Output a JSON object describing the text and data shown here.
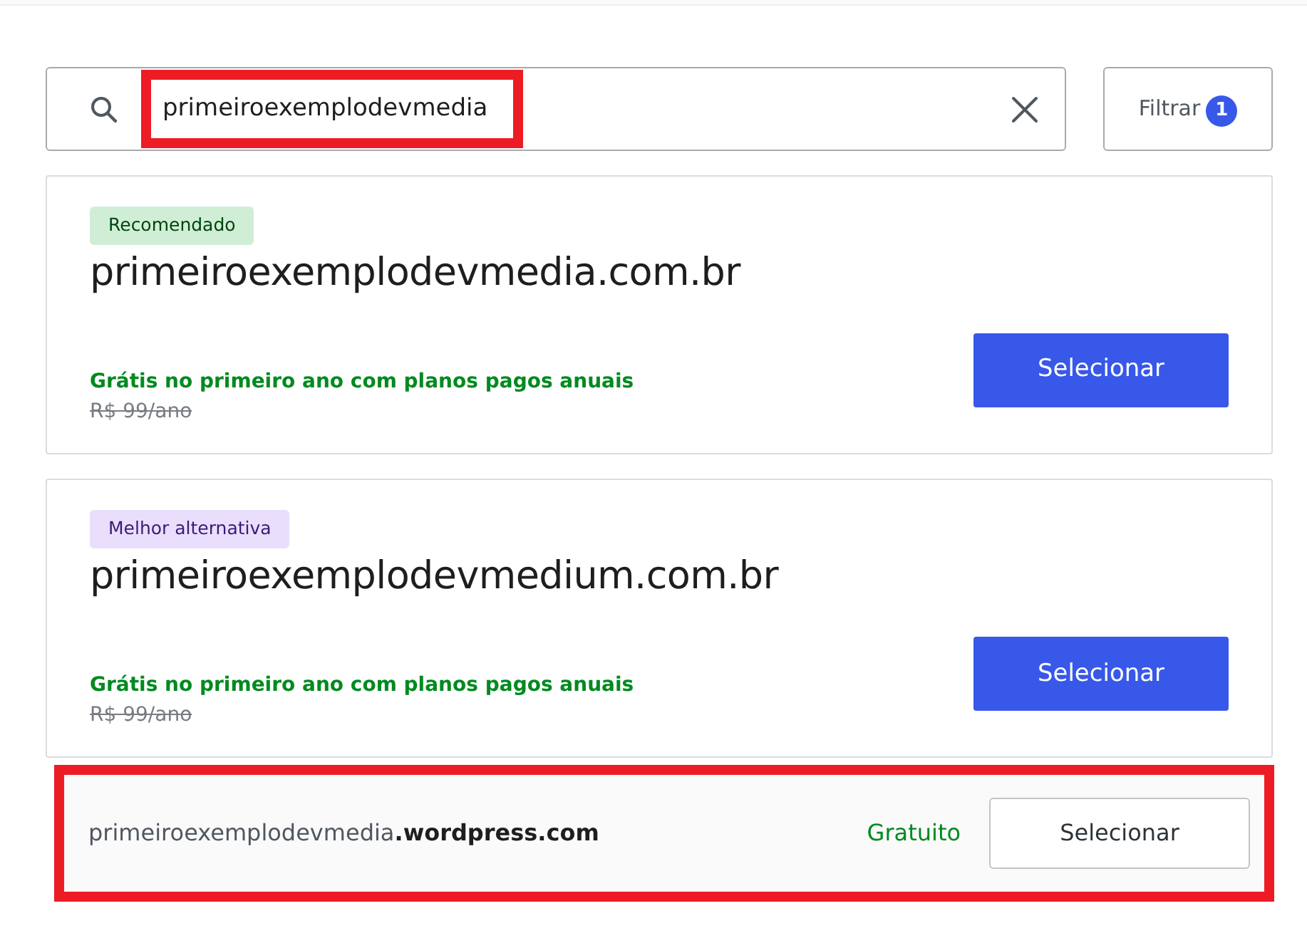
{
  "search": {
    "value": "primeiroexemplodevmedia",
    "highlighted": true
  },
  "filter": {
    "label": "Filtrar",
    "count": "1"
  },
  "suggestions": [
    {
      "badge": "Recomendado",
      "kind": "recommended",
      "domain": "primeiroexemplodevmedia.com.br",
      "offer": "Grátis no primeiro ano com planos pagos anuais",
      "old_price": "R$ 99/ano",
      "button": "Selecionar"
    },
    {
      "badge": "Melhor alternativa",
      "kind": "alternative",
      "domain": "primeiroexemplodevmedium.com.br",
      "offer": "Grátis no primeiro ano com planos pagos anuais",
      "old_price": "R$ 99/ano",
      "button": "Selecionar"
    }
  ],
  "free_option": {
    "domain": "primeiroexemplodevmedia**.wordpress.com**",
    "price": "Gratuito",
    "button": "Selecionar",
    "highlighted": true
  }
}
